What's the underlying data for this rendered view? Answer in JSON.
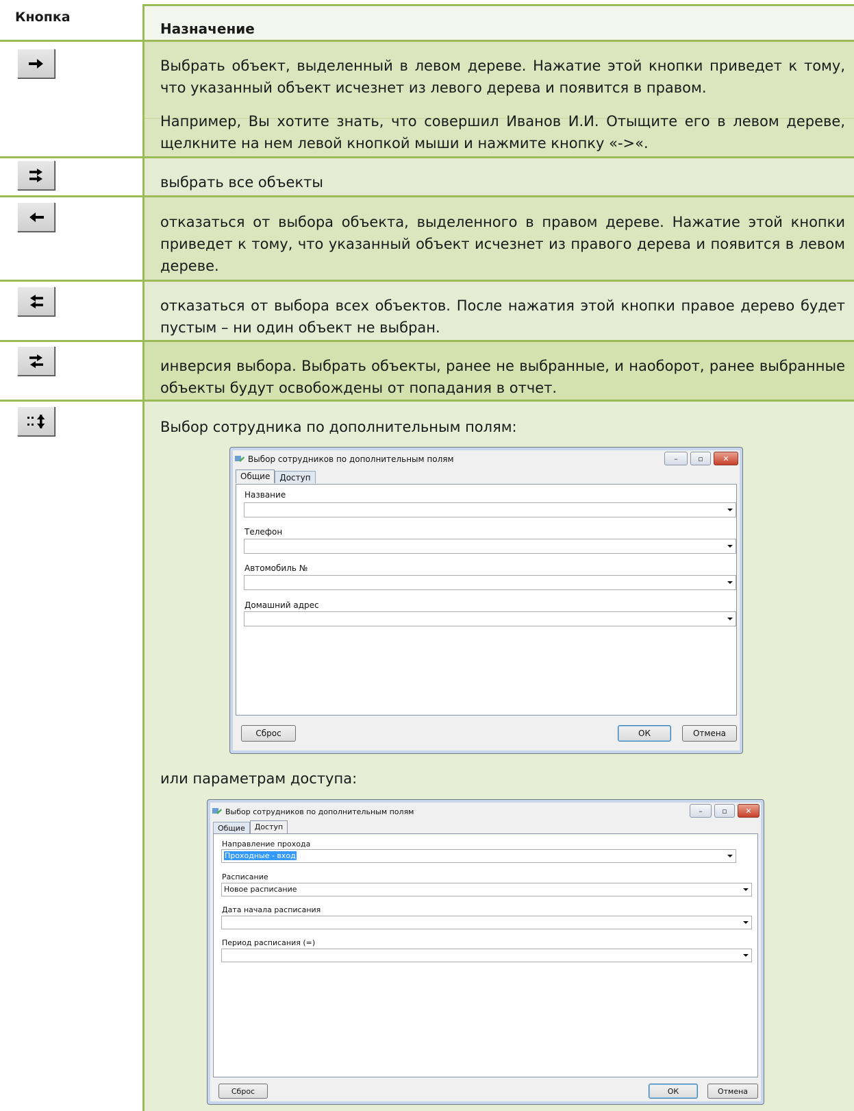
{
  "header": {
    "col_button": "Кнопка",
    "col_purpose": "Назначение"
  },
  "rows": [
    {
      "icon": "arrow-right-icon",
      "paragraphs": [
        "Выбрать объект, выделенный в левом дереве. Нажатие этой кнопки приведет к тому, что указанный объект исчезнет из левого дерева и появится в правом.",
        "Например, Вы хотите знать, что совершил Иванов И.И. Отыщите его в левом дереве, щелкните на нем левой кнопкой мыши и нажмите кнопку «->«."
      ]
    },
    {
      "icon": "double-arrow-right-icon",
      "paragraphs": [
        "выбрать все объекты"
      ]
    },
    {
      "icon": "arrow-left-icon",
      "paragraphs": [
        "отказаться от выбора объекта, выделенного в правом дереве. Нажатие этой кнопки приведет к тому, что указанный объект исчезнет из правого дерева и появится в левом дереве."
      ]
    },
    {
      "icon": "double-arrow-left-icon",
      "paragraphs": [
        "отказаться от выбора всех объектов. После нажатия этой кнопки правое дерево будет пустым – ни один объект не выбран."
      ]
    },
    {
      "icon": "swap-arrows-icon",
      "paragraphs": [
        "инверсия выбора. Выбрать объекты, ранее не выбранные, и наоборот, ранее выбранные объекты будут освобождены от попадания в отчет."
      ]
    },
    {
      "icon": "filter-select-icon",
      "paragraphs": [
        "Выбор сотрудника по дополнительным полям:",
        "или параметрам доступа:"
      ]
    }
  ],
  "dialog1": {
    "title": "Выбор сотрудников по дополнительным полям",
    "tabs": [
      "Общие",
      "Доступ"
    ],
    "active_tab": "Общие",
    "fields": [
      {
        "label": "Название",
        "value": ""
      },
      {
        "label": "Телефон",
        "value": ""
      },
      {
        "label": "Автомобиль №",
        "value": ""
      },
      {
        "label": "Домашний адрес",
        "value": ""
      }
    ],
    "reset_label": "Сброс",
    "ok_label": "ОК",
    "cancel_label": "Отмена"
  },
  "dialog2": {
    "title": "Выбор сотрудников по дополнительным полям",
    "tabs": [
      "Общие",
      "Доступ"
    ],
    "active_tab": "Доступ",
    "fields": [
      {
        "label": "Направление прохода",
        "value": "Проходные - вход"
      },
      {
        "label": "Расписание",
        "value": "Новое расписание"
      },
      {
        "label": "Дата начала расписания",
        "value": ""
      },
      {
        "label": "Период расписания (=)",
        "value": ""
      }
    ],
    "reset_label": "Сброс",
    "ok_label": "ОК",
    "cancel_label": "Отмена"
  },
  "colors": {
    "rule": "#9bbb59",
    "header_bg": "#f2f6ea",
    "row_bg_a": "#dde9c4",
    "row_bg_b": "#e4ecd2"
  }
}
